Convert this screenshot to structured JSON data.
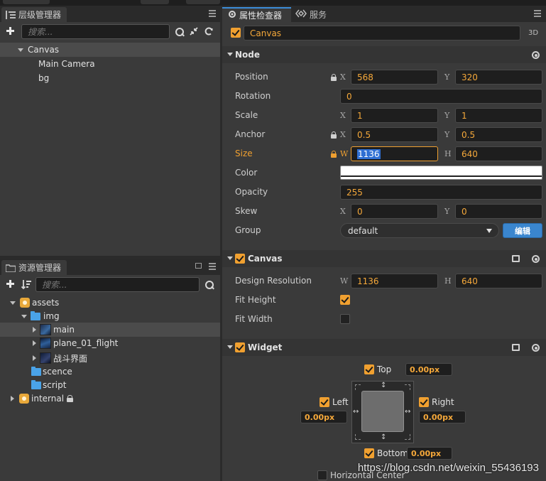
{
  "hierarchy": {
    "title": "层级管理器",
    "search_placeholder": "搜索...",
    "nodes": [
      {
        "label": "Canvas",
        "expanded": true
      },
      {
        "label": "Main Camera"
      },
      {
        "label": "bg"
      }
    ]
  },
  "assets": {
    "title": "资源管理器",
    "search_placeholder": "搜索...",
    "items": [
      {
        "label": "assets",
        "icon": "package-icon"
      },
      {
        "label": "img",
        "icon": "folder-icon"
      },
      {
        "label": "main",
        "icon": "image-thumb"
      },
      {
        "label": "plane_01_flight",
        "icon": "image-thumb"
      },
      {
        "label": "战斗界面",
        "icon": "image-thumb"
      },
      {
        "label": "scence",
        "icon": "folder-icon"
      },
      {
        "label": "script",
        "icon": "folder-icon"
      },
      {
        "label": "internal",
        "icon": "package-icon"
      }
    ]
  },
  "inspector": {
    "tab_active": "属性检查器",
    "tab_other": "服务",
    "node_name": "Canvas",
    "mode_3d": "3D",
    "node_section": {
      "title": "Node",
      "position": {
        "label": "Position",
        "x_axis": "X",
        "x": "568",
        "y_axis": "Y",
        "y": "320"
      },
      "rotation": {
        "label": "Rotation",
        "value": "0"
      },
      "scale": {
        "label": "Scale",
        "x_axis": "X",
        "x": "1",
        "y_axis": "Y",
        "y": "1"
      },
      "anchor": {
        "label": "Anchor",
        "x_axis": "X",
        "x": "0.5",
        "y_axis": "Y",
        "y": "0.5"
      },
      "size": {
        "label": "Size",
        "w_axis": "W",
        "w": "1136",
        "h_axis": "H",
        "h": "640"
      },
      "color": {
        "label": "Color",
        "value": "#ffffff"
      },
      "opacity": {
        "label": "Opacity",
        "value": "255"
      },
      "skew": {
        "label": "Skew",
        "x_axis": "X",
        "x": "0",
        "y_axis": "Y",
        "y": "0"
      },
      "group": {
        "label": "Group",
        "value": "default",
        "edit_button": "编辑"
      }
    },
    "canvas_section": {
      "title": "Canvas",
      "design_resolution": {
        "label": "Design Resolution",
        "w_axis": "W",
        "w": "1136",
        "h_axis": "H",
        "h": "640"
      },
      "fit_height": {
        "label": "Fit Height",
        "checked": true
      },
      "fit_width": {
        "label": "Fit Width",
        "checked": false
      }
    },
    "widget_section": {
      "title": "Widget",
      "top": {
        "label": "Top",
        "value": "0.00px"
      },
      "left": {
        "label": "Left",
        "value": "0.00px"
      },
      "right": {
        "label": "Right",
        "value": "0.00px"
      },
      "bottom": {
        "label": "Bottom",
        "value": "0.00px"
      },
      "horizontal_center": {
        "label": "Horizontal Center"
      }
    }
  },
  "watermark": "https://blog.csdn.net/weixin_55436193",
  "colors": {
    "accent": "#f0a030",
    "active_tab": "#3c8dd8",
    "button": "#3a86cf"
  }
}
